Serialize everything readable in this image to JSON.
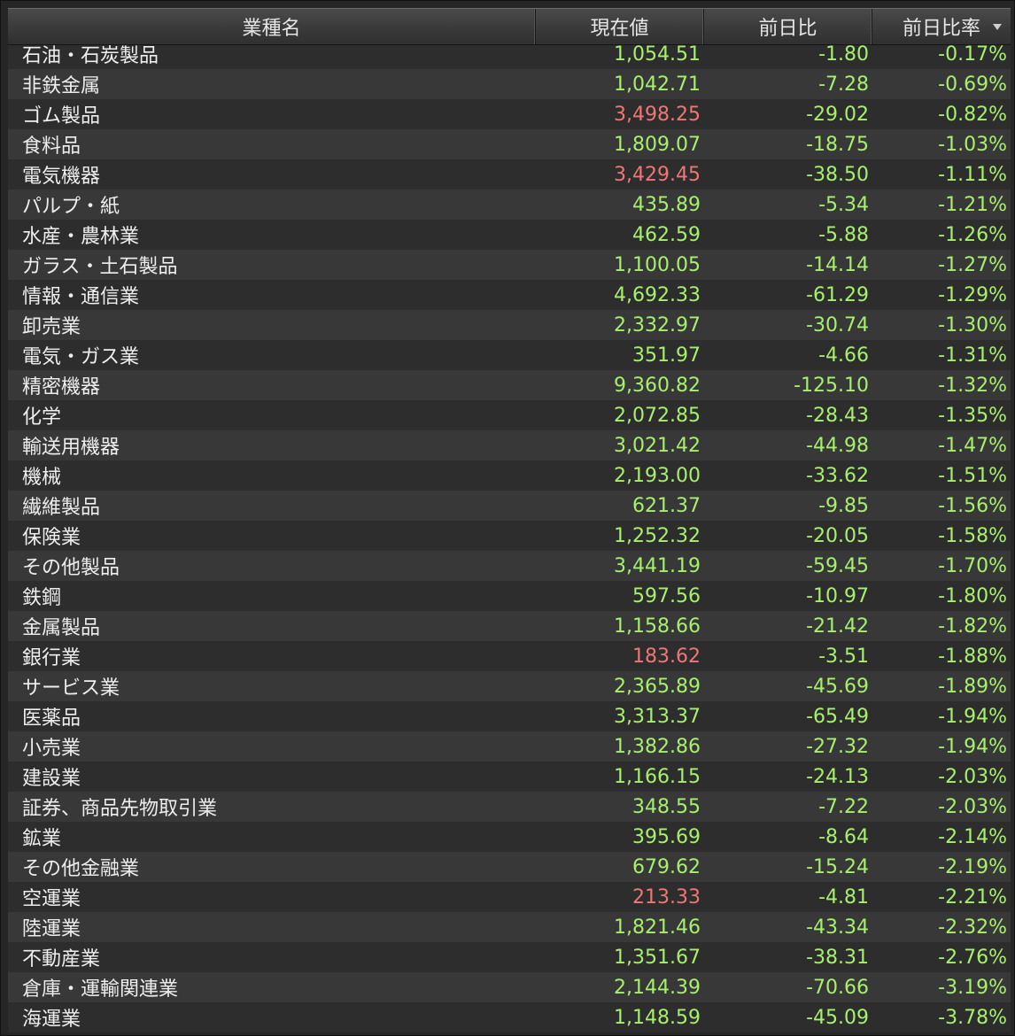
{
  "colors": {
    "negative": "#a6f06e",
    "highlight": "#f07676",
    "text": "#eeeeee"
  },
  "header": {
    "name": "業種名",
    "current": "現在値",
    "change": "前日比",
    "change_pct": "前日比率",
    "sort_icon": "sort-desc-icon"
  },
  "rows": [
    {
      "name": "石油・石炭製品",
      "current": "1,054.51",
      "change": "-1.80",
      "change_pct": "-0.17%",
      "cur_color": "#a6f06e"
    },
    {
      "name": "非鉄金属",
      "current": "1,042.71",
      "change": "-7.28",
      "change_pct": "-0.69%",
      "cur_color": "#a6f06e"
    },
    {
      "name": "ゴム製品",
      "current": "3,498.25",
      "change": "-29.02",
      "change_pct": "-0.82%",
      "cur_color": "#f07676"
    },
    {
      "name": "食料品",
      "current": "1,809.07",
      "change": "-18.75",
      "change_pct": "-1.03%",
      "cur_color": "#a6f06e"
    },
    {
      "name": "電気機器",
      "current": "3,429.45",
      "change": "-38.50",
      "change_pct": "-1.11%",
      "cur_color": "#f07676"
    },
    {
      "name": "パルプ・紙",
      "current": "435.89",
      "change": "-5.34",
      "change_pct": "-1.21%",
      "cur_color": "#a6f06e"
    },
    {
      "name": "水産・農林業",
      "current": "462.59",
      "change": "-5.88",
      "change_pct": "-1.26%",
      "cur_color": "#a6f06e"
    },
    {
      "name": "ガラス・土石製品",
      "current": "1,100.05",
      "change": "-14.14",
      "change_pct": "-1.27%",
      "cur_color": "#a6f06e"
    },
    {
      "name": "情報・通信業",
      "current": "4,692.33",
      "change": "-61.29",
      "change_pct": "-1.29%",
      "cur_color": "#a6f06e"
    },
    {
      "name": "卸売業",
      "current": "2,332.97",
      "change": "-30.74",
      "change_pct": "-1.30%",
      "cur_color": "#a6f06e"
    },
    {
      "name": "電気・ガス業",
      "current": "351.97",
      "change": "-4.66",
      "change_pct": "-1.31%",
      "cur_color": "#a6f06e"
    },
    {
      "name": "精密機器",
      "current": "9,360.82",
      "change": "-125.10",
      "change_pct": "-1.32%",
      "cur_color": "#a6f06e"
    },
    {
      "name": "化学",
      "current": "2,072.85",
      "change": "-28.43",
      "change_pct": "-1.35%",
      "cur_color": "#a6f06e"
    },
    {
      "name": "輸送用機器",
      "current": "3,021.42",
      "change": "-44.98",
      "change_pct": "-1.47%",
      "cur_color": "#a6f06e"
    },
    {
      "name": "機械",
      "current": "2,193.00",
      "change": "-33.62",
      "change_pct": "-1.51%",
      "cur_color": "#a6f06e"
    },
    {
      "name": "繊維製品",
      "current": "621.37",
      "change": "-9.85",
      "change_pct": "-1.56%",
      "cur_color": "#a6f06e"
    },
    {
      "name": "保険業",
      "current": "1,252.32",
      "change": "-20.05",
      "change_pct": "-1.58%",
      "cur_color": "#a6f06e"
    },
    {
      "name": "その他製品",
      "current": "3,441.19",
      "change": "-59.45",
      "change_pct": "-1.70%",
      "cur_color": "#a6f06e"
    },
    {
      "name": "鉄鋼",
      "current": "597.56",
      "change": "-10.97",
      "change_pct": "-1.80%",
      "cur_color": "#a6f06e"
    },
    {
      "name": "金属製品",
      "current": "1,158.66",
      "change": "-21.42",
      "change_pct": "-1.82%",
      "cur_color": "#a6f06e"
    },
    {
      "name": "銀行業",
      "current": "183.62",
      "change": "-3.51",
      "change_pct": "-1.88%",
      "cur_color": "#f07676"
    },
    {
      "name": "サービス業",
      "current": "2,365.89",
      "change": "-45.69",
      "change_pct": "-1.89%",
      "cur_color": "#a6f06e"
    },
    {
      "name": "医薬品",
      "current": "3,313.37",
      "change": "-65.49",
      "change_pct": "-1.94%",
      "cur_color": "#a6f06e"
    },
    {
      "name": "小売業",
      "current": "1,382.86",
      "change": "-27.32",
      "change_pct": "-1.94%",
      "cur_color": "#a6f06e"
    },
    {
      "name": "建設業",
      "current": "1,166.15",
      "change": "-24.13",
      "change_pct": "-2.03%",
      "cur_color": "#a6f06e"
    },
    {
      "name": "証券、商品先物取引業",
      "current": "348.55",
      "change": "-7.22",
      "change_pct": "-2.03%",
      "cur_color": "#a6f06e"
    },
    {
      "name": "鉱業",
      "current": "395.69",
      "change": "-8.64",
      "change_pct": "-2.14%",
      "cur_color": "#a6f06e"
    },
    {
      "name": "その他金融業",
      "current": "679.62",
      "change": "-15.24",
      "change_pct": "-2.19%",
      "cur_color": "#a6f06e"
    },
    {
      "name": "空運業",
      "current": "213.33",
      "change": "-4.81",
      "change_pct": "-2.21%",
      "cur_color": "#f07676"
    },
    {
      "name": "陸運業",
      "current": "1,821.46",
      "change": "-43.34",
      "change_pct": "-2.32%",
      "cur_color": "#a6f06e"
    },
    {
      "name": "不動産業",
      "current": "1,351.67",
      "change": "-38.31",
      "change_pct": "-2.76%",
      "cur_color": "#a6f06e"
    },
    {
      "name": "倉庫・運輸関連業",
      "current": "2,144.39",
      "change": "-70.66",
      "change_pct": "-3.19%",
      "cur_color": "#a6f06e"
    },
    {
      "name": "海運業",
      "current": "1,148.59",
      "change": "-45.09",
      "change_pct": "-3.78%",
      "cur_color": "#a6f06e"
    }
  ]
}
